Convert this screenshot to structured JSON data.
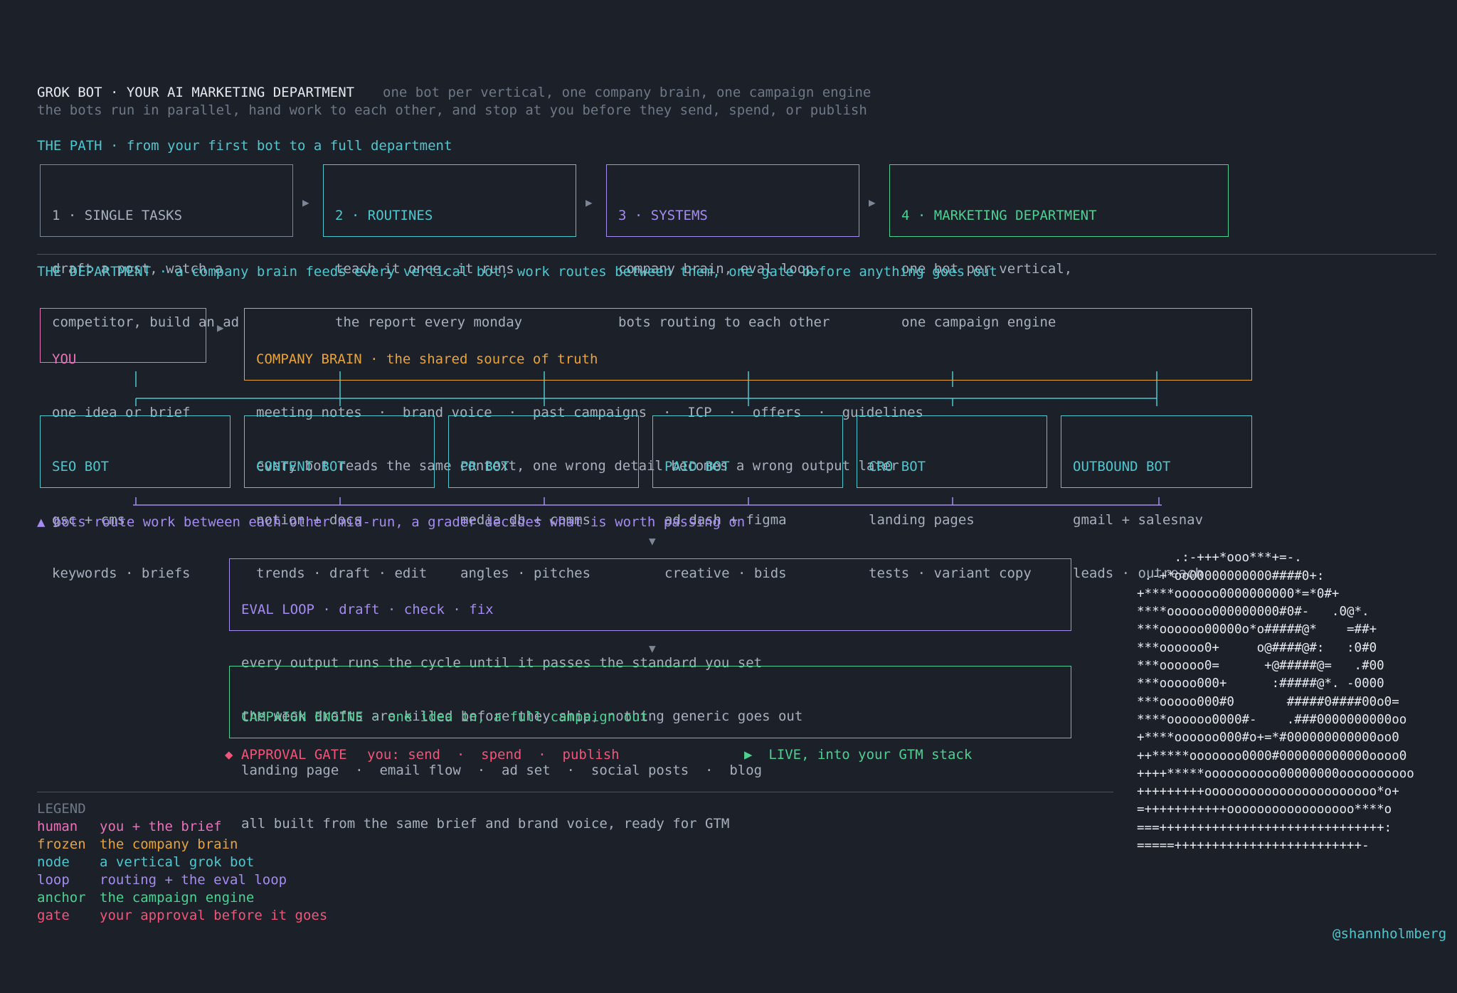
{
  "header": {
    "title": "GROK BOT · YOUR AI MARKETING DEPARTMENT",
    "tagline": "one bot per vertical, one company brain, one campaign engine",
    "subtitle": "the bots run in parallel, hand work to each other, and stop at you before they send, spend, or publish"
  },
  "path": {
    "heading": "THE PATH · from your first bot to a full department",
    "stages": [
      {
        "title": "1 · SINGLE TASKS",
        "line1": "draft a post, watch a",
        "line2": "competitor, build an ad"
      },
      {
        "title": "2 · ROUTINES",
        "line1": "teach it once, it runs",
        "line2": "the report every monday"
      },
      {
        "title": "3 · SYSTEMS",
        "line1": "company brain, eval loop,",
        "line2": "bots routing to each other"
      },
      {
        "title": "4 · MARKETING DEPARTMENT",
        "line1": "one bot per vertical,",
        "line2": "one campaign engine"
      }
    ],
    "arrow": "▶"
  },
  "department": {
    "heading": "THE DEPARTMENT · a company brain feeds every vertical bot, work routes between them, one gate before anything goes out",
    "you": {
      "title": "YOU",
      "line1": "one idea or brief"
    },
    "brain": {
      "title": "COMPANY BRAIN · the shared source of truth",
      "line1": "meeting notes  ·  brand voice  ·  past campaigns  ·  ICP  ·  offers  ·  guidelines",
      "line2": "every bot reads the same context, one wrong detail becomes a wrong output later"
    },
    "bots": [
      {
        "title": "SEO BOT",
        "line1": "gsc + cms",
        "line2": "keywords · briefs"
      },
      {
        "title": "CONTENT BOT",
        "line1": "notion + docs",
        "line2": "trends · draft · edit"
      },
      {
        "title": "PR BOT",
        "line1": "media db + comms",
        "line2": "angles · pitches"
      },
      {
        "title": "PAID BOT",
        "line1": "ad dash + figma",
        "line2": "creative · bids"
      },
      {
        "title": "CRO BOT",
        "line1": "landing pages",
        "line2": "tests · variant copy"
      },
      {
        "title": "OUTBOUND BOT",
        "line1": "gmail + salesnav",
        "line2": "leads · outreach"
      }
    ],
    "routing_note": "▲ bots route work between each other mid-run, a grader decides what is worth passing on",
    "down_arrow": "▼",
    "eval": {
      "title": "EVAL LOOP · draft · check · fix",
      "line1": "every output runs the cycle until it passes the standard you set",
      "line2": "the weak drafts are killed before they ship, nothing generic goes out"
    },
    "engine": {
      "title": "CAMPAIGN ENGINE · one idea in, a full campaign out",
      "line1": "landing page  ·  email flow  ·  ad set  ·  social posts  ·  blog",
      "line2": "all built from the same brief and brand voice, ready for GTM"
    },
    "gate": {
      "label": "◆ APPROVAL GATE",
      "actions": "you: send  ·  spend  ·  publish",
      "live": "▶  LIVE, into your GTM stack"
    }
  },
  "legend": {
    "heading": "LEGEND",
    "items": [
      {
        "key": "human",
        "desc": "you + the brief",
        "color": "#e873b8"
      },
      {
        "key": "frozen",
        "desc": "the company brain",
        "color": "#e8a33d"
      },
      {
        "key": "node",
        "desc": "a vertical grok bot",
        "color": "#4fc7cf"
      },
      {
        "key": "loop",
        "desc": "routing + the eval loop",
        "color": "#a48cf0"
      },
      {
        "key": "anchor",
        "desc": "the campaign engine",
        "color": "#4fcf93"
      },
      {
        "key": "gate",
        "desc": "your approval before it goes",
        "color": "#f2557a"
      }
    ]
  },
  "ascii_art": [
    "     .:-+++*ooo***+=-.",
    " .-+*oo00000000000####0+:",
    "+****oooooo0000000000*=*0#+",
    "****oooooo000000000#0#-   .0@*.",
    "***oooooo00000o*o#####@*    =##+",
    "***oooooo0+     o@####@#:   :0#0",
    "***oooooo0=      +@#####@=   .#00",
    "***ooooo000+      :#####@*. -0000",
    "***ooooo000#0       #####0####00o0=",
    "****oooooo0000#-    .###0000000000oo",
    "+****oooooo000#o+=*#000000000000oo0",
    "++*****ooooooo0000#000000000000oooo0",
    "++++*****oooooooooo00000000oooooooooo",
    "+++++++++ooooooooooooooooooooooo*o+",
    "=+++++++++++ooooooooooooooooo****o",
    "===++++++++++++++++++++++++++++++:",
    "=====+++++++++++++++++++++++++-"
  ],
  "credit": "@shannholmberg",
  "colors": {
    "background": "#1b2029",
    "cyan": "#4fc7cf",
    "purple": "#a48cf0",
    "green": "#4fcf93",
    "orange": "#e8a33d",
    "pink": "#e873b8",
    "red": "#f2557a"
  }
}
